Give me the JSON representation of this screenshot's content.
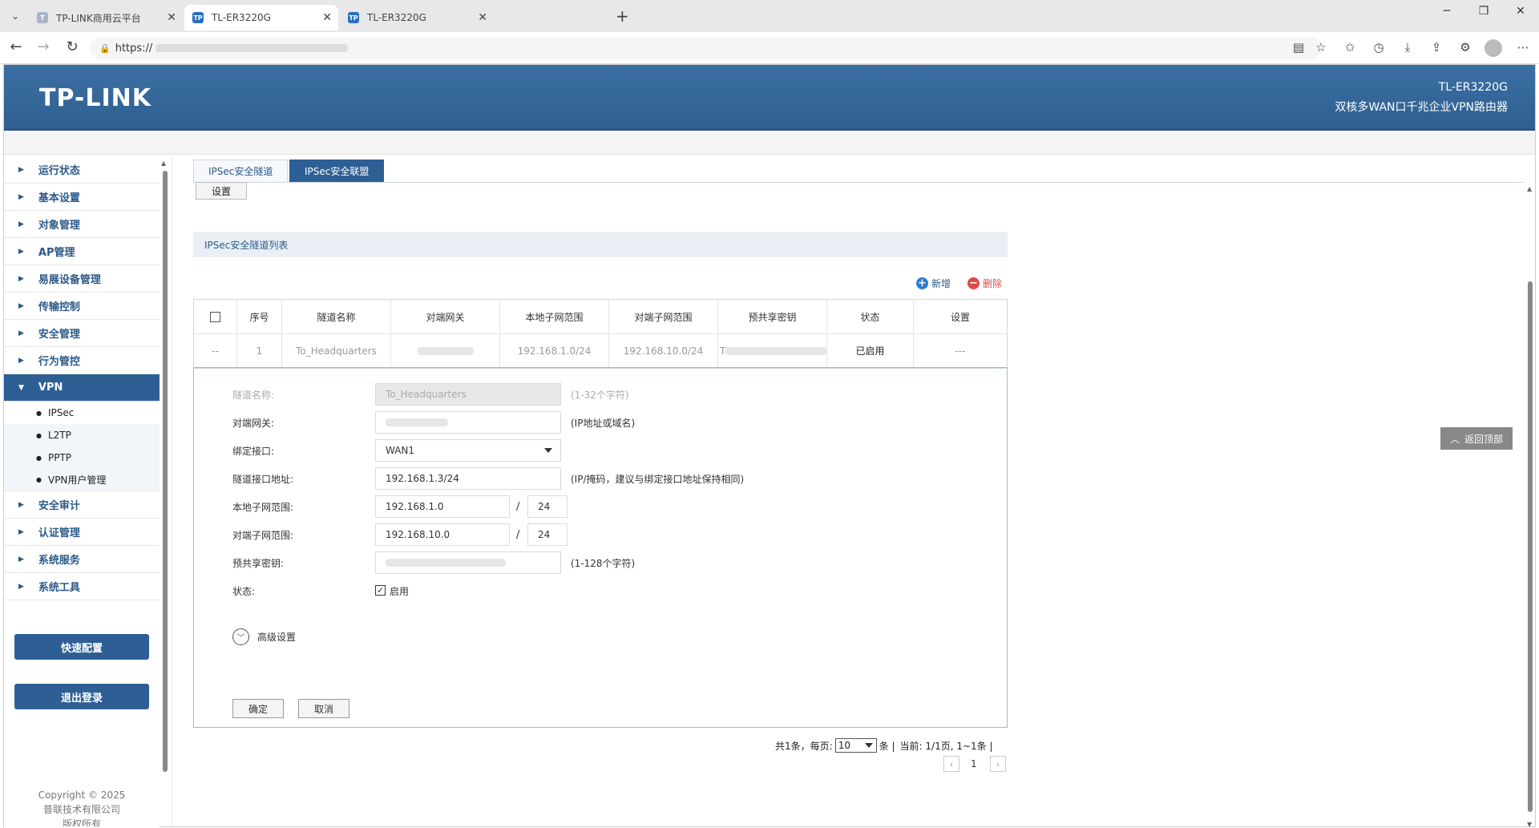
{
  "browser": {
    "tabs": [
      {
        "title": "TP-LINK商用云平台",
        "fav": "T",
        "favcolor": "#aab4c8"
      },
      {
        "title": "TL-ER3220G",
        "fav": "TP",
        "favcolor": "#2a6fc1"
      },
      {
        "title": "TL-ER3220G",
        "fav": "TP",
        "favcolor": "#2a6fc1"
      }
    ],
    "url": "https://"
  },
  "header": {
    "logo": "TP-LINK",
    "model": "TL-ER3220G",
    "desc": "双核多WAN口千兆企业VPN路由器"
  },
  "sidebar": {
    "items": [
      "运行状态",
      "基本设置",
      "对象管理",
      "AP管理",
      "易展设备管理",
      "传输控制",
      "安全管理",
      "行为管控",
      "VPN"
    ],
    "vpn_sub": [
      "IPSec",
      "L2TP",
      "PPTP",
      "VPN用户管理"
    ],
    "items_after": [
      "安全审计",
      "认证管理",
      "系统服务",
      "系统工具"
    ],
    "quick_config": "快速配置",
    "logout": "退出登录",
    "copyright": [
      "Copyright © 2025",
      "普联技术有限公司",
      "版权所有"
    ]
  },
  "tabs": [
    "IPSec安全隧道",
    "IPSec安全联盟"
  ],
  "settings_button": "设置",
  "section_title": "IPSec安全隧道列表",
  "actions": {
    "add": "新增",
    "delete": "删除"
  },
  "table": {
    "headers": [
      "序号",
      "隧道名称",
      "对端网关",
      "本地子网范围",
      "对端子网范围",
      "预共享密钥",
      "状态",
      "设置"
    ],
    "row": {
      "select": "--",
      "index": "1",
      "name": "To_Headquarters",
      "local": "192.168.1.0/24",
      "remote": "192.168.10.0/24",
      "psk_prefix": "T",
      "status": "已启用",
      "settings": "---"
    }
  },
  "form": {
    "tunnel_name_label": "隧道名称:",
    "tunnel_name_value": "To_Headquarters",
    "tunnel_name_hint": "(1-32个字符)",
    "peer_gw_label": "对端网关:",
    "peer_gw_hint": "(IP地址或域名)",
    "bind_iface_label": "绑定接口:",
    "bind_iface_value": "WAN1",
    "tunnel_addr_label": "隧道接口地址:",
    "tunnel_addr_value": "192.168.1.3/24",
    "tunnel_addr_hint": "(IP/掩码，建议与绑定接口地址保持相同)",
    "local_subnet_label": "本地子网范围:",
    "local_subnet_value": "192.168.1.0",
    "local_subnet_mask": "24",
    "remote_subnet_label": "对端子网范围:",
    "remote_subnet_value": "192.168.10.0",
    "remote_subnet_mask": "24",
    "psk_label": "预共享密钥:",
    "psk_hint": "(1-128个字符)",
    "status_label": "状态:",
    "status_check": "启用",
    "slash": "/",
    "advanced": "高级设置",
    "ok": "确定",
    "cancel": "取消"
  },
  "pager": {
    "total": "共1条，每页:",
    "per_page": "10",
    "unit": "条 |",
    "current": "当前: 1/1页, 1~1条 |",
    "page": "1"
  },
  "back_to_top": "返回顶部"
}
